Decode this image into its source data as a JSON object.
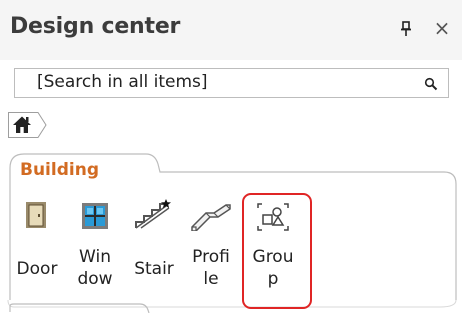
{
  "header": {
    "title": "Design center",
    "close_glyph": "×",
    "pin_icon": "pin-icon"
  },
  "search": {
    "text": "[Search in all items]",
    "icon": "search-icon"
  },
  "breadcrumb": {
    "home_icon": "home-icon"
  },
  "group": {
    "label": "Building",
    "items": [
      {
        "label_line1": "Door",
        "label_line2": "",
        "icon": "door-icon"
      },
      {
        "label_line1": "Win",
        "label_line2": "dow",
        "icon": "window-icon"
      },
      {
        "label_line1": "Stair",
        "label_line2": "",
        "icon": "stair-icon"
      },
      {
        "label_line1": "Profi",
        "label_line2": "le",
        "icon": "profile-icon"
      },
      {
        "label_line1": "Grou",
        "label_line2": "p",
        "icon": "group-icon"
      }
    ]
  },
  "colors": {
    "accent": "#d26b22",
    "highlight": "#e02525"
  }
}
